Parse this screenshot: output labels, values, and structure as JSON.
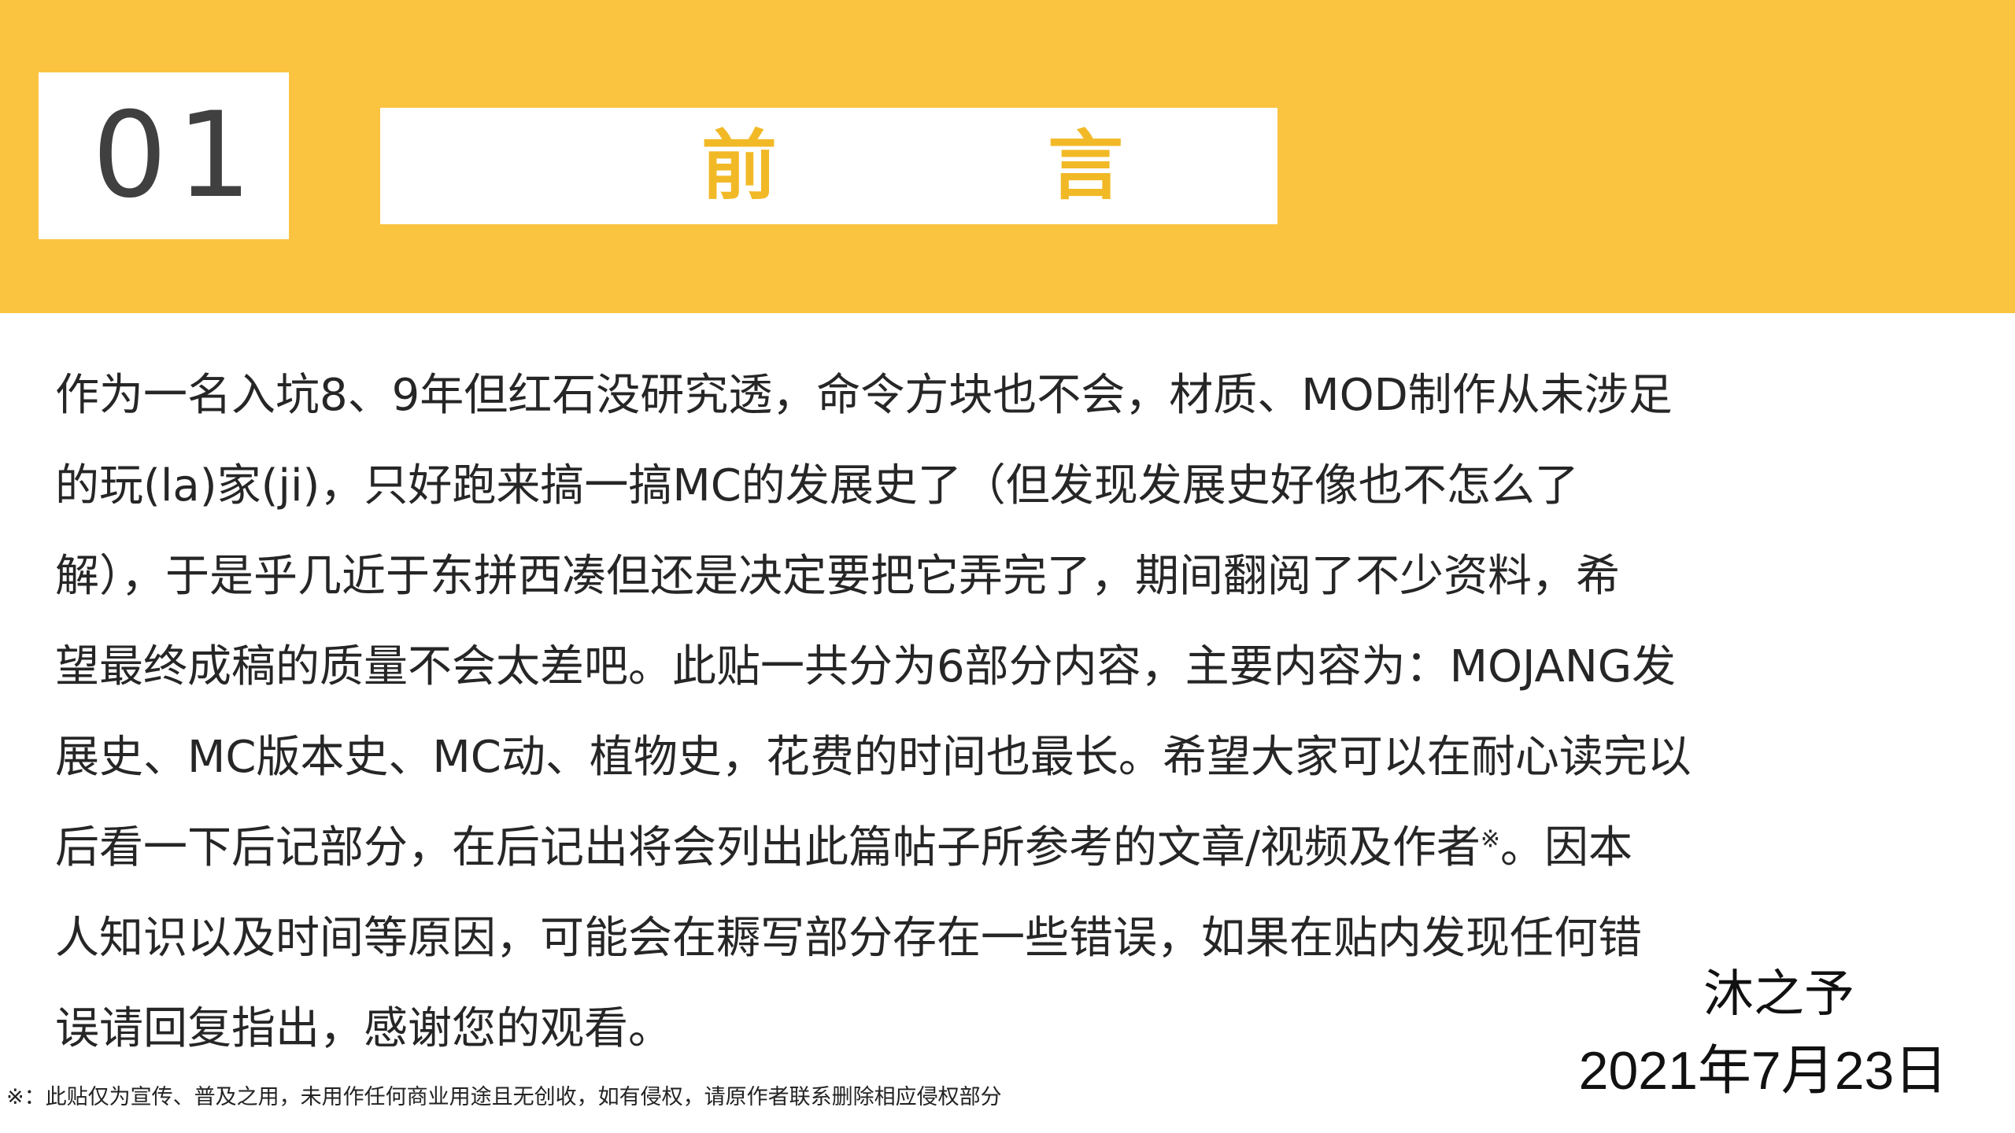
{
  "header": {
    "number": "01",
    "title": "前　言"
  },
  "body": {
    "lines": [
      "作为一名入坑8、9年但红石没研究透，命令方块也不会，材质、MOD制作从未涉足",
      "的玩(la)家(ji)，只好跑来搞一搞MC的发展史了（但发现发展史好像也不怎么了",
      "解），于是乎几近于东拼西凑但还是决定要把它弄完了，期间翻阅了不少资料，希",
      "望最终成稿的质量不会太差吧。此贴一共分为6部分内容，主要内容为：MOJANG发",
      "展史、MC版本史、MC动、植物史，花费的时间也最长。希望大家可以在耐心读完以",
      "后看一下后记部分，在后记出将会列出此篇帖子所参考的文章/视频及作者",
      "人知识以及时间等原因，可能会在耨写部分存在一些错误，如果在贴内发现任何错",
      "误请回复指出，感谢您的观看。"
    ],
    "line6_mark": "※",
    "line6_tail": "。因本"
  },
  "signature": {
    "author": "沐之予",
    "date": "2021年7月23日"
  },
  "footnote": "※：此贴仅为宣传、普及之用，未用作任何商业用途且无创收，如有侵权，请原作者联系删除相应侵权部分",
  "colors": {
    "band": "#FAC441",
    "title": "#F2B927",
    "text": "#262626"
  }
}
